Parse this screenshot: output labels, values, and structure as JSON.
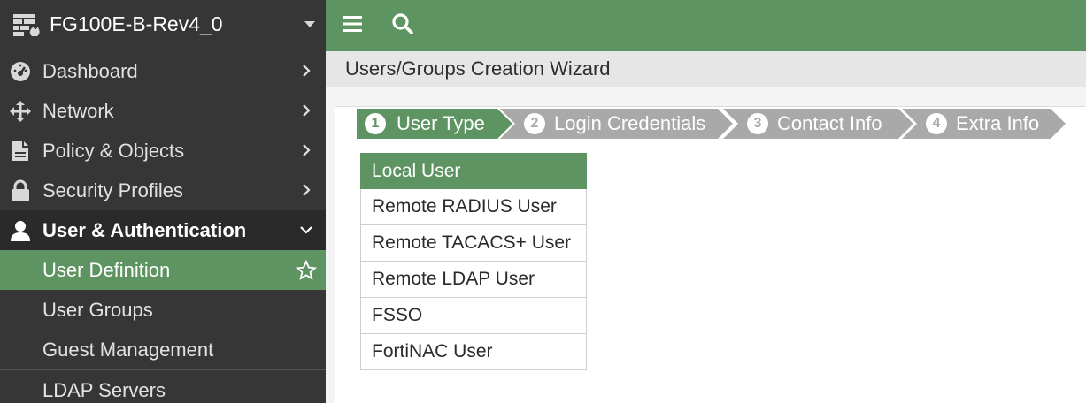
{
  "sidebar": {
    "device_name": "FG100E-B-Rev4_0",
    "items": [
      {
        "label": "Dashboard",
        "icon": "dashboard-gauge-icon"
      },
      {
        "label": "Network",
        "icon": "network-move-icon"
      },
      {
        "label": "Policy & Objects",
        "icon": "policy-document-icon"
      },
      {
        "label": "Security Profiles",
        "icon": "lock-icon"
      },
      {
        "label": "User & Authentication",
        "icon": "user-icon"
      }
    ],
    "subitems": [
      {
        "label": "User Definition"
      },
      {
        "label": "User Groups"
      },
      {
        "label": "Guest Management"
      },
      {
        "label": "LDAP Servers"
      }
    ]
  },
  "topbar": {
    "menu_icon": "hamburger-menu-icon",
    "search_icon": "search-icon"
  },
  "page": {
    "title": "Users/Groups Creation Wizard"
  },
  "wizard": {
    "steps": [
      {
        "number": "1",
        "label": "User Type"
      },
      {
        "number": "2",
        "label": "Login Credentials"
      },
      {
        "number": "3",
        "label": "Contact Info"
      },
      {
        "number": "4",
        "label": "Extra Info"
      }
    ],
    "user_types": [
      "Local User",
      "Remote RADIUS User",
      "Remote TACACS+ User",
      "Remote LDAP User",
      "FSSO",
      "FortiNAC User"
    ]
  },
  "colors": {
    "accent_green": "#5e9461",
    "sidebar_bg": "#363636",
    "step_inactive": "#a9a9a9"
  }
}
